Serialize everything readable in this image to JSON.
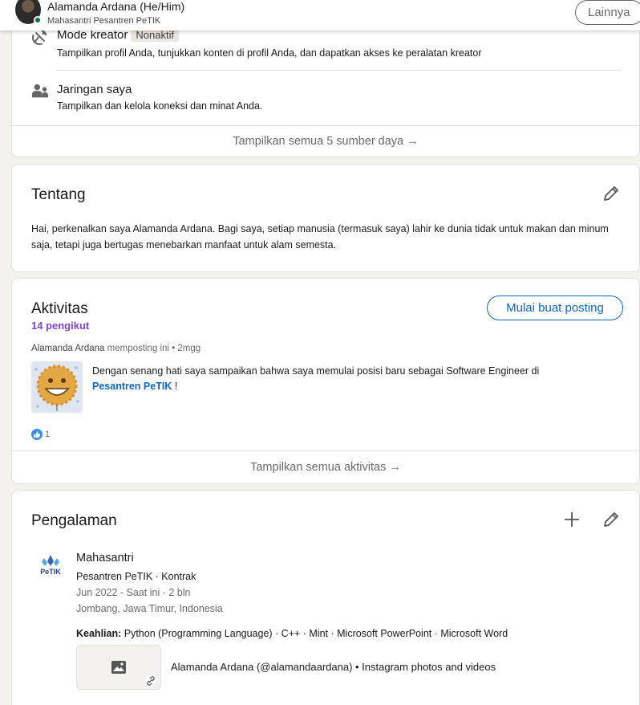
{
  "header": {
    "name": "Alamanda Ardana (He/Him)",
    "headline": "Mahasantri Pesantren PeTIK",
    "more_label": "Lainnya"
  },
  "resources": {
    "items": [
      {
        "icon": "satellite-dish-icon",
        "title": "Mode kreator",
        "badge": "Nonaktif",
        "description": "Tampilkan profil Anda, tunjukkan konten di profil Anda, dan dapatkan akses ke peralatan kreator"
      },
      {
        "icon": "people-icon",
        "title": "Jaringan saya",
        "description": "Tampilkan dan kelola koneksi dan minat Anda."
      }
    ],
    "show_all": "Tampilkan semua 5 sumber daya →"
  },
  "about": {
    "title": "Tentang",
    "text": "Hai, perkenalkan saya Alamanda Ardana. Bagi saya, setiap manusia (termasuk saya) lahir ke dunia tidak untuk makan dan minum saja, tetapi juga bertugas menebarkan manfaat untuk alam semesta."
  },
  "activity": {
    "title": "Aktivitas",
    "followers": "14 pengikut",
    "create_post": "Mulai buat posting",
    "post": {
      "author": "Alamanda Ardana",
      "action": "memposting ini",
      "time": "• 2mgg",
      "text": "Dengan senang hati saya sampaikan bahwa saya memulai posisi baru sebagai Software Engineer di",
      "link": "Pesantren PeTIK",
      "text_end": "!",
      "reactions": "1"
    },
    "show_all": "Tampilkan semua aktivitas →"
  },
  "experience": {
    "title": "Pengalaman",
    "items": [
      {
        "logo_text": "PeTIK",
        "role": "Mahasantri",
        "company": "Pesantren PeTIK · Kontrak",
        "dates": "Jun 2022 - Saat ini · 2 bln",
        "location": "Jombang, Jawa Timur, Indonesia",
        "skills_label": "Keahlian:",
        "skills": "Python (Programming Language) · C++ · Mint · Microsoft PowerPoint · Microsoft Word",
        "media_title": "Alamanda Ardana (@alamandaardana) • Instagram photos and videos"
      }
    ]
  },
  "colors": {
    "primary": "#0a66c2",
    "followers": "#8344cc",
    "background": "#f4f2ee",
    "online": "#01754f"
  }
}
